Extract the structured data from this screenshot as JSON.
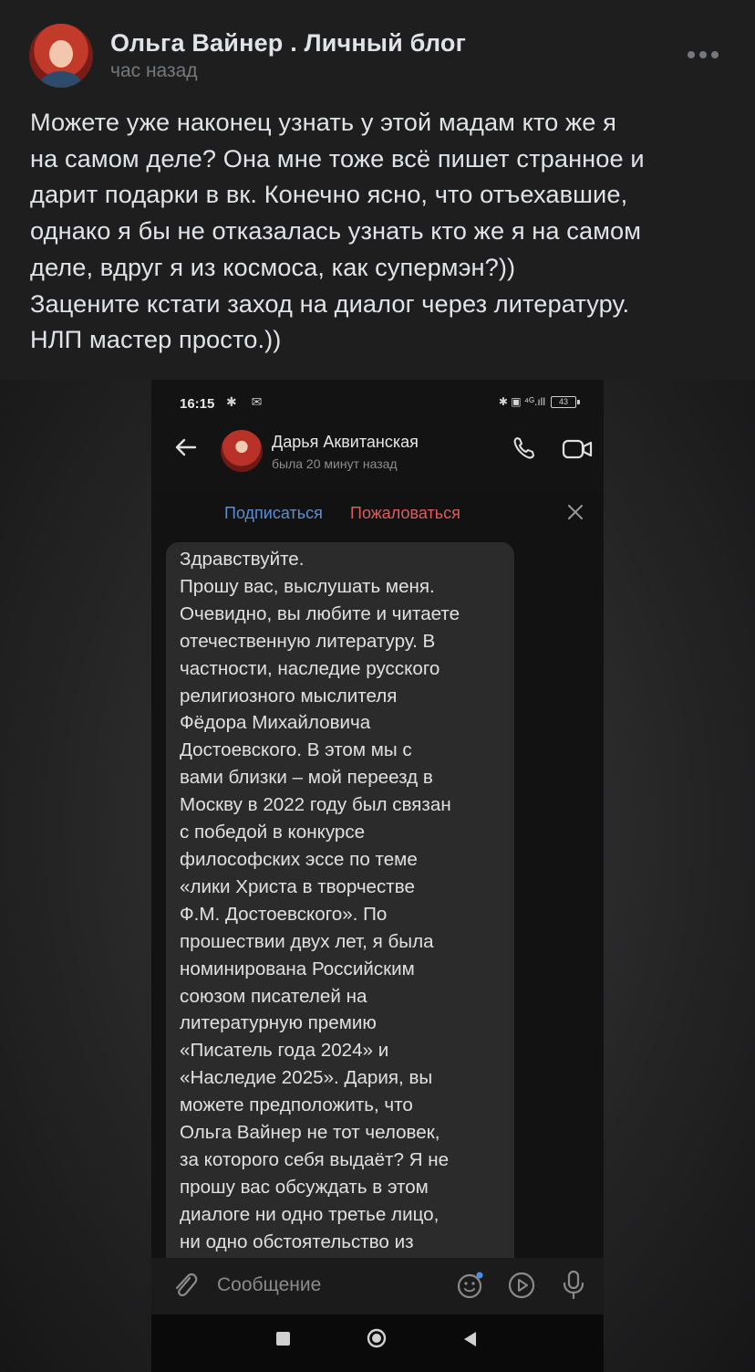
{
  "post": {
    "author": "Ольга Вайнер . Личный блог",
    "time": "час назад",
    "text_lines": [
      "Можете уже наконец узнать у этой мадам кто же я",
      "на самом деле? Она мне тоже всё пишет странное и",
      "дарит подарки в вк. Конечно ясно, что отъехавшие,",
      "однако я бы не отказалась узнать кто же я на самом",
      "деле, вдруг я из космоса, как супермэн?))",
      "Зацените кстати заход на диалог через литературу.",
      "НЛП мастер просто.))"
    ]
  },
  "screenshot": {
    "status_time": "16:15",
    "status_left_icons": "✱ ✉",
    "status_right": "✱ ▣ ⁴ᴳ.ıll",
    "battery": "43",
    "contact_name": "Дарья Аквитанская",
    "contact_status": "была 20 минут назад",
    "subscribe_label": "Подписаться",
    "report_label": "Пожаловаться",
    "message_lines": [
      "Здравствуйте.",
      "Прошу вас, выслушать меня.",
      "Очевидно, вы любите и читаете",
      "отечественную литературу. В",
      "частности, наследие русского",
      "религиозного мыслителя",
      "Фёдора Михайловича",
      "Достоевского. В этом мы с",
      "вами близки – мой переезд в",
      "Москву в 2022 году был связан",
      "с победой в конкурсе",
      "философских эссе по теме",
      "«лики Христа в творчестве",
      "Ф.М. Достоевского». По",
      "прошествии двух лет, я была",
      "номинирована Российским",
      "союзом писателей на",
      "литературную премию",
      "«Писатель года 2024» и",
      "«Наследие 2025». Дария, вы",
      "можете предположить, что",
      "Ольга Вайнер не тот человек,",
      "за которого себя выдаёт? Я не",
      "прошу вас обсуждать в этом",
      "диалоге ни одно третье лицо,",
      "ни одно обстоятельство из"
    ],
    "input_placeholder": "Сообщение"
  }
}
